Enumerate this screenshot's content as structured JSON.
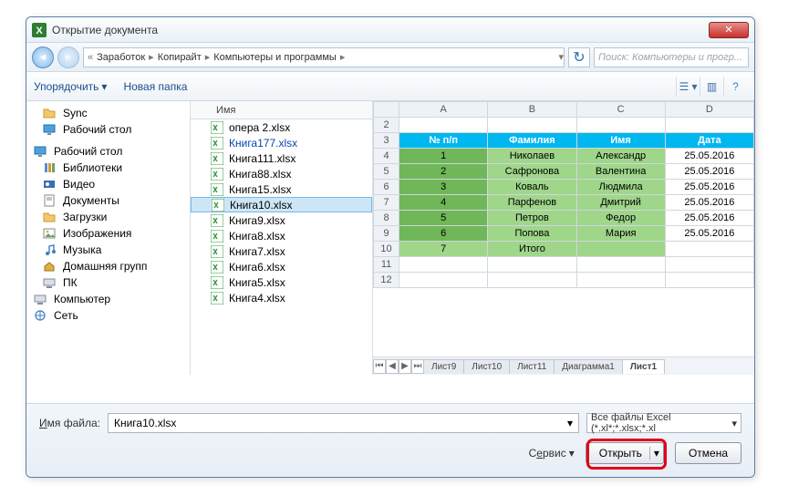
{
  "title": "Открытие документа",
  "breadcrumb": [
    "Заработок",
    "Копирайт",
    "Компьютеры и программы"
  ],
  "search_placeholder": "Поиск: Компьютеры и прогр...",
  "toolbar": {
    "organize": "Упорядочить",
    "newfolder": "Новая папка"
  },
  "sidebar": [
    {
      "label": "Sync",
      "icon": "#ico-folder"
    },
    {
      "label": "Рабочий стол",
      "icon": "#ico-desktop"
    },
    {
      "sep": true
    },
    {
      "label": "Рабочий стол",
      "icon": "#ico-desktop",
      "root": true
    },
    {
      "label": "Библиотеки",
      "icon": "#ico-lib"
    },
    {
      "label": "Видео",
      "icon": "#ico-video"
    },
    {
      "label": "Документы",
      "icon": "#ico-doc"
    },
    {
      "label": "Загрузки",
      "icon": "#ico-folder"
    },
    {
      "label": "Изображения",
      "icon": "#ico-img"
    },
    {
      "label": "Музыка",
      "icon": "#ico-music"
    },
    {
      "label": "Домашняя групп",
      "icon": "#ico-home"
    },
    {
      "label": "ПК",
      "icon": "#ico-pc"
    },
    {
      "label": "Компьютер",
      "icon": "#ico-pc",
      "root": true
    },
    {
      "label": "Сеть",
      "icon": "#ico-net",
      "root": true
    }
  ],
  "files_header": "Имя",
  "files": [
    {
      "name": "опера 2.xlsx"
    },
    {
      "name": "Книга177.xlsx",
      "link": true
    },
    {
      "name": "Книга111.xlsx"
    },
    {
      "name": "Книга88.xlsx"
    },
    {
      "name": "Книга15.xlsx"
    },
    {
      "name": "Книга10.xlsx",
      "selected": true
    },
    {
      "name": "Книга9.xlsx"
    },
    {
      "name": "Книга8.xlsx"
    },
    {
      "name": "Книга7.xlsx"
    },
    {
      "name": "Книга6.xlsx"
    },
    {
      "name": "Книга5.xlsx"
    },
    {
      "name": "Книга4.xlsx"
    }
  ],
  "sheet": {
    "cols": [
      "A",
      "B",
      "C",
      "D"
    ],
    "rowstart": 2,
    "header": [
      "№ п/п",
      "Фамилия",
      "Имя",
      "Дата"
    ],
    "rows": [
      [
        "1",
        "Николаев",
        "Александр",
        "25.05.2016"
      ],
      [
        "2",
        "Сафронова",
        "Валентина",
        "25.05.2016"
      ],
      [
        "3",
        "Коваль",
        "Людмила",
        "25.05.2016"
      ],
      [
        "4",
        "Парфенов",
        "Дмитрий",
        "25.05.2016"
      ],
      [
        "5",
        "Петров",
        "Федор",
        "25.05.2016"
      ],
      [
        "6",
        "Попова",
        "Мария",
        "25.05.2016"
      ]
    ],
    "total": [
      "7",
      "Итого",
      "",
      ""
    ],
    "tabs": [
      "Лист9",
      "Лист10",
      "Лист11",
      "Диаграмма1",
      "Лист1"
    ],
    "active_tab": 4
  },
  "footer": {
    "fname_label": "Имя файла:",
    "fname_value": "Книга10.xlsx",
    "ftype": "Все файлы Excel (*.xl*;*.xlsx;*.xl",
    "service": "Сервис",
    "open": "Открыть",
    "cancel": "Отмена"
  }
}
